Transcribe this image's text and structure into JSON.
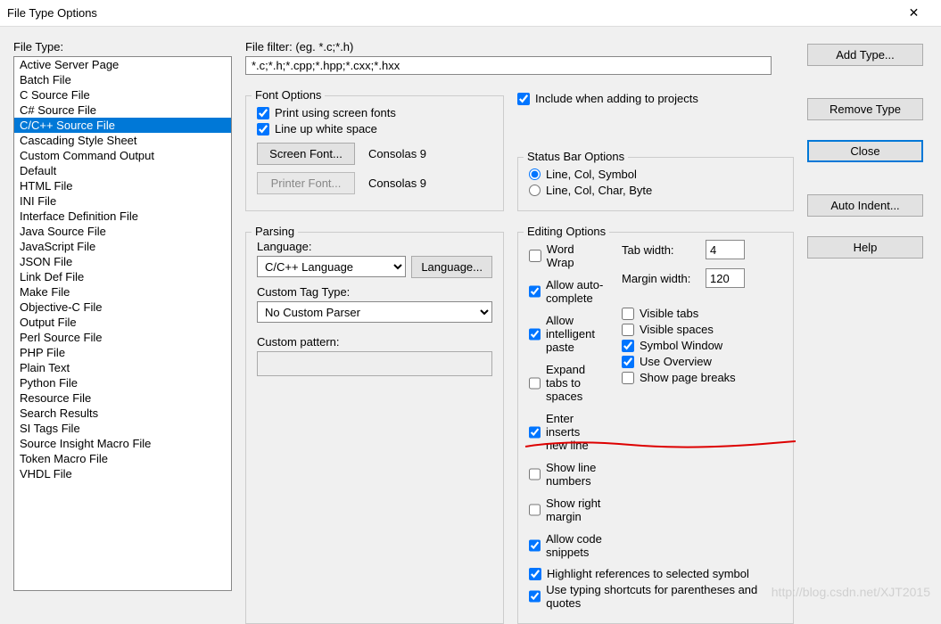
{
  "window": {
    "title": "File Type Options"
  },
  "leftPanel": {
    "label": "File Type:",
    "items": [
      "Active Server Page",
      "Batch File",
      "C Source File",
      "C# Source File",
      "C/C++ Source File",
      "Cascading Style Sheet",
      "Custom Command Output",
      "Default",
      "HTML File",
      "INI File",
      "Interface Definition File",
      "Java Source File",
      "JavaScript File",
      "JSON File",
      "Link Def File",
      "Make File",
      "Objective-C File",
      "Output File",
      "Perl Source File",
      "PHP File",
      "Plain Text",
      "Python File",
      "Resource File",
      "Search Results",
      "SI Tags File",
      "Source Insight Macro File",
      "Token Macro File",
      "VHDL File"
    ],
    "selectedIndex": 4
  },
  "filter": {
    "label": "File filter: (eg. *.c;*.h)",
    "value": "*.c;*.h;*.cpp;*.hpp;*.cxx;*.hxx"
  },
  "fontOptions": {
    "legend": "Font Options",
    "printScreenFonts": {
      "label": "Print using screen fonts",
      "checked": true
    },
    "lineUpWhite": {
      "label": "Line up white space",
      "checked": true
    },
    "screenFontBtn": "Screen Font...",
    "printerFontBtn": "Printer Font...",
    "screenFontName": "Consolas 9",
    "printerFontName": "Consolas 9"
  },
  "include": {
    "label": "Include when adding to projects",
    "checked": true
  },
  "statusBar": {
    "legend": "Status Bar Options",
    "opt1": "Line, Col, Symbol",
    "opt2": "Line, Col, Char, Byte",
    "selected": "opt1"
  },
  "parsing": {
    "legend": "Parsing",
    "langLabel": "Language:",
    "langValue": "C/C++ Language",
    "langBtn": "Language...",
    "customTagLabel": "Custom Tag Type:",
    "customTagValue": "No Custom Parser",
    "customPatternLabel": "Custom pattern:",
    "customPatternValue": ""
  },
  "editing": {
    "legend": "Editing Options",
    "left": [
      {
        "label": "Word Wrap",
        "checked": false
      },
      {
        "label": "Allow auto-complete",
        "checked": true
      },
      {
        "label": "Allow intelligent paste",
        "checked": true
      },
      {
        "label": "Expand tabs to spaces",
        "checked": false
      },
      {
        "label": "Enter inserts new line",
        "checked": true
      },
      {
        "label": "Show line numbers",
        "checked": false
      },
      {
        "label": "Show right margin",
        "checked": false
      },
      {
        "label": "Allow code snippets",
        "checked": true
      }
    ],
    "tabWidth": {
      "label": "Tab width:",
      "value": "4"
    },
    "marginWidth": {
      "label": "Margin width:",
      "value": "120"
    },
    "right": [
      {
        "label": "Visible tabs",
        "checked": false
      },
      {
        "label": "Visible spaces",
        "checked": false
      },
      {
        "label": "Symbol Window",
        "checked": true
      },
      {
        "label": "Use Overview",
        "checked": true
      },
      {
        "label": "Show page breaks",
        "checked": false
      }
    ],
    "bottom": [
      {
        "label": "Highlight references to selected symbol",
        "checked": true
      },
      {
        "label": "Use typing shortcuts for parentheses and quotes",
        "checked": true
      }
    ]
  },
  "sideButtons": {
    "addType": "Add Type...",
    "removeType": "Remove Type",
    "close": "Close",
    "autoIndent": "Auto Indent...",
    "help": "Help"
  },
  "watermark": "http://blog.csdn.net/XJT2015"
}
